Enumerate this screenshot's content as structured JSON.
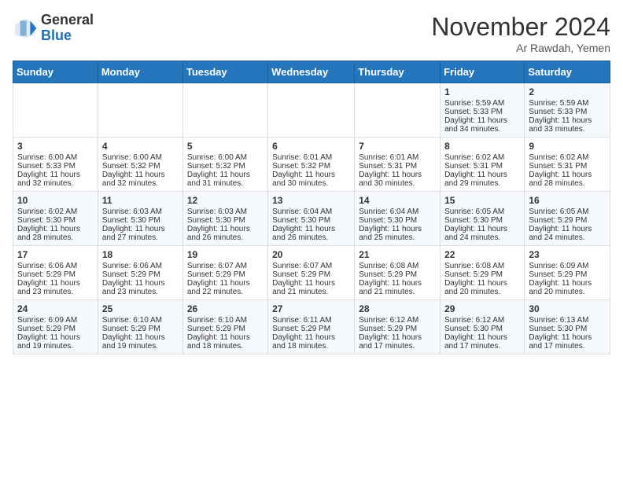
{
  "logo": {
    "general": "General",
    "blue": "Blue"
  },
  "title": "November 2024",
  "subtitle": "Ar Rawdah, Yemen",
  "headers": [
    "Sunday",
    "Monday",
    "Tuesday",
    "Wednesday",
    "Thursday",
    "Friday",
    "Saturday"
  ],
  "weeks": [
    [
      {
        "day": "",
        "sunrise": "",
        "sunset": "",
        "daylight": ""
      },
      {
        "day": "",
        "sunrise": "",
        "sunset": "",
        "daylight": ""
      },
      {
        "day": "",
        "sunrise": "",
        "sunset": "",
        "daylight": ""
      },
      {
        "day": "",
        "sunrise": "",
        "sunset": "",
        "daylight": ""
      },
      {
        "day": "",
        "sunrise": "",
        "sunset": "",
        "daylight": ""
      },
      {
        "day": "1",
        "sunrise": "Sunrise: 5:59 AM",
        "sunset": "Sunset: 5:33 PM",
        "daylight": "Daylight: 11 hours and 34 minutes."
      },
      {
        "day": "2",
        "sunrise": "Sunrise: 5:59 AM",
        "sunset": "Sunset: 5:33 PM",
        "daylight": "Daylight: 11 hours and 33 minutes."
      }
    ],
    [
      {
        "day": "3",
        "sunrise": "Sunrise: 6:00 AM",
        "sunset": "Sunset: 5:33 PM",
        "daylight": "Daylight: 11 hours and 32 minutes."
      },
      {
        "day": "4",
        "sunrise": "Sunrise: 6:00 AM",
        "sunset": "Sunset: 5:32 PM",
        "daylight": "Daylight: 11 hours and 32 minutes."
      },
      {
        "day": "5",
        "sunrise": "Sunrise: 6:00 AM",
        "sunset": "Sunset: 5:32 PM",
        "daylight": "Daylight: 11 hours and 31 minutes."
      },
      {
        "day": "6",
        "sunrise": "Sunrise: 6:01 AM",
        "sunset": "Sunset: 5:32 PM",
        "daylight": "Daylight: 11 hours and 30 minutes."
      },
      {
        "day": "7",
        "sunrise": "Sunrise: 6:01 AM",
        "sunset": "Sunset: 5:31 PM",
        "daylight": "Daylight: 11 hours and 30 minutes."
      },
      {
        "day": "8",
        "sunrise": "Sunrise: 6:02 AM",
        "sunset": "Sunset: 5:31 PM",
        "daylight": "Daylight: 11 hours and 29 minutes."
      },
      {
        "day": "9",
        "sunrise": "Sunrise: 6:02 AM",
        "sunset": "Sunset: 5:31 PM",
        "daylight": "Daylight: 11 hours and 28 minutes."
      }
    ],
    [
      {
        "day": "10",
        "sunrise": "Sunrise: 6:02 AM",
        "sunset": "Sunset: 5:30 PM",
        "daylight": "Daylight: 11 hours and 28 minutes."
      },
      {
        "day": "11",
        "sunrise": "Sunrise: 6:03 AM",
        "sunset": "Sunset: 5:30 PM",
        "daylight": "Daylight: 11 hours and 27 minutes."
      },
      {
        "day": "12",
        "sunrise": "Sunrise: 6:03 AM",
        "sunset": "Sunset: 5:30 PM",
        "daylight": "Daylight: 11 hours and 26 minutes."
      },
      {
        "day": "13",
        "sunrise": "Sunrise: 6:04 AM",
        "sunset": "Sunset: 5:30 PM",
        "daylight": "Daylight: 11 hours and 26 minutes."
      },
      {
        "day": "14",
        "sunrise": "Sunrise: 6:04 AM",
        "sunset": "Sunset: 5:30 PM",
        "daylight": "Daylight: 11 hours and 25 minutes."
      },
      {
        "day": "15",
        "sunrise": "Sunrise: 6:05 AM",
        "sunset": "Sunset: 5:30 PM",
        "daylight": "Daylight: 11 hours and 24 minutes."
      },
      {
        "day": "16",
        "sunrise": "Sunrise: 6:05 AM",
        "sunset": "Sunset: 5:29 PM",
        "daylight": "Daylight: 11 hours and 24 minutes."
      }
    ],
    [
      {
        "day": "17",
        "sunrise": "Sunrise: 6:06 AM",
        "sunset": "Sunset: 5:29 PM",
        "daylight": "Daylight: 11 hours and 23 minutes."
      },
      {
        "day": "18",
        "sunrise": "Sunrise: 6:06 AM",
        "sunset": "Sunset: 5:29 PM",
        "daylight": "Daylight: 11 hours and 23 minutes."
      },
      {
        "day": "19",
        "sunrise": "Sunrise: 6:07 AM",
        "sunset": "Sunset: 5:29 PM",
        "daylight": "Daylight: 11 hours and 22 minutes."
      },
      {
        "day": "20",
        "sunrise": "Sunrise: 6:07 AM",
        "sunset": "Sunset: 5:29 PM",
        "daylight": "Daylight: 11 hours and 21 minutes."
      },
      {
        "day": "21",
        "sunrise": "Sunrise: 6:08 AM",
        "sunset": "Sunset: 5:29 PM",
        "daylight": "Daylight: 11 hours and 21 minutes."
      },
      {
        "day": "22",
        "sunrise": "Sunrise: 6:08 AM",
        "sunset": "Sunset: 5:29 PM",
        "daylight": "Daylight: 11 hours and 20 minutes."
      },
      {
        "day": "23",
        "sunrise": "Sunrise: 6:09 AM",
        "sunset": "Sunset: 5:29 PM",
        "daylight": "Daylight: 11 hours and 20 minutes."
      }
    ],
    [
      {
        "day": "24",
        "sunrise": "Sunrise: 6:09 AM",
        "sunset": "Sunset: 5:29 PM",
        "daylight": "Daylight: 11 hours and 19 minutes."
      },
      {
        "day": "25",
        "sunrise": "Sunrise: 6:10 AM",
        "sunset": "Sunset: 5:29 PM",
        "daylight": "Daylight: 11 hours and 19 minutes."
      },
      {
        "day": "26",
        "sunrise": "Sunrise: 6:10 AM",
        "sunset": "Sunset: 5:29 PM",
        "daylight": "Daylight: 11 hours and 18 minutes."
      },
      {
        "day": "27",
        "sunrise": "Sunrise: 6:11 AM",
        "sunset": "Sunset: 5:29 PM",
        "daylight": "Daylight: 11 hours and 18 minutes."
      },
      {
        "day": "28",
        "sunrise": "Sunrise: 6:12 AM",
        "sunset": "Sunset: 5:29 PM",
        "daylight": "Daylight: 11 hours and 17 minutes."
      },
      {
        "day": "29",
        "sunrise": "Sunrise: 6:12 AM",
        "sunset": "Sunset: 5:30 PM",
        "daylight": "Daylight: 11 hours and 17 minutes."
      },
      {
        "day": "30",
        "sunrise": "Sunrise: 6:13 AM",
        "sunset": "Sunset: 5:30 PM",
        "daylight": "Daylight: 11 hours and 17 minutes."
      }
    ]
  ]
}
